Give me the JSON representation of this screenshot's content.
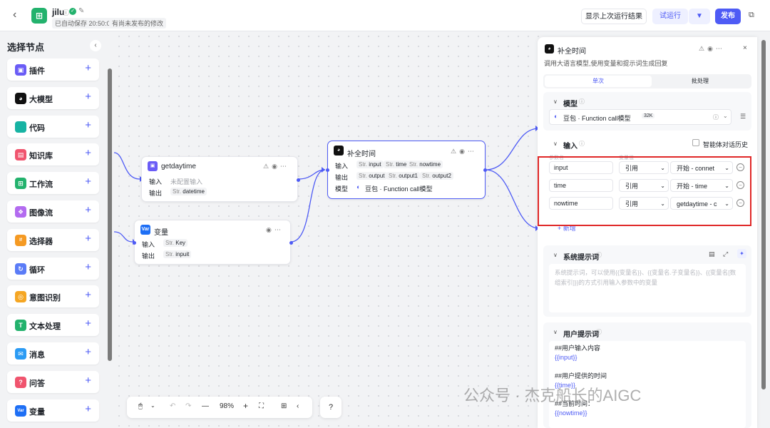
{
  "header": {
    "title": "jilu",
    "autosave": "已自动保存 20:50:03",
    "unpublished": "有尚未发布的修改",
    "show_last_run": "显示上次运行结果",
    "test_run": "试运行",
    "publish": "发布"
  },
  "sidebar": {
    "title": "选择节点",
    "items": [
      {
        "label": "插件",
        "icon": "plugin-icon",
        "color": "#6a5cf6"
      },
      {
        "label": "大模型",
        "icon": "llm-icon",
        "color": "#111111"
      },
      {
        "label": "代码",
        "icon": "code-icon",
        "color": "#17b3a3"
      },
      {
        "label": "知识库",
        "icon": "knowledge-icon",
        "color": "#f0546e"
      },
      {
        "label": "工作流",
        "icon": "workflow-icon",
        "color": "#23b26d"
      },
      {
        "label": "图像流",
        "icon": "imageflow-icon",
        "color": "#b36bf0"
      },
      {
        "label": "选择器",
        "icon": "selector-icon",
        "color": "#f59a23"
      },
      {
        "label": "循环",
        "icon": "loop-icon",
        "color": "#5b7cf7"
      },
      {
        "label": "意图识别",
        "icon": "intent-icon",
        "color": "#f5a623"
      },
      {
        "label": "文本处理",
        "icon": "text-icon",
        "color": "#23b26d"
      },
      {
        "label": "消息",
        "icon": "message-icon",
        "color": "#2b9bf4"
      },
      {
        "label": "问答",
        "icon": "qa-icon",
        "color": "#f0546e"
      },
      {
        "label": "变量",
        "icon": "variable-icon",
        "color": "#1e6ff5"
      }
    ]
  },
  "nodes": {
    "getdaytime": {
      "title": "getdaytime",
      "in_label": "输入",
      "in_value": "未配置输入",
      "out_label": "输出",
      "out_type": "Str.",
      "out_var": "datetime"
    },
    "variable": {
      "title": "变量",
      "icon_text": "Var",
      "in_label": "输入",
      "in_type": "Str.",
      "in_var": "Key",
      "out_label": "输出",
      "out_type": "Str.",
      "out_var": "inpuit"
    },
    "llm": {
      "title": "补全时间",
      "in_label": "输入",
      "ins": [
        "input",
        "time",
        "nowtime"
      ],
      "out_label": "输出",
      "outs": [
        "output",
        "output1",
        "output2"
      ],
      "type": "Str.",
      "model_label": "模型",
      "model": "豆包 · Function call模型"
    }
  },
  "panel": {
    "title": "补全时间",
    "desc": "调用大语言模型,使用变量和提示词生成回复",
    "tabs": [
      "单次",
      "批处理"
    ],
    "model_section": "模型",
    "model_name": "豆包 · Function call模型",
    "model_badge": "32K",
    "input_section": "输入",
    "history_label": "智能体对话历史",
    "col_name": "参数名",
    "col_value": "变量值",
    "rows": [
      {
        "name": "input",
        "mode": "引用",
        "ref": "开始 - connet"
      },
      {
        "name": "time",
        "mode": "引用",
        "ref": "开始 - time"
      },
      {
        "name": "nowtime",
        "mode": "引用",
        "ref": "getdaytime - c"
      }
    ],
    "add": "+ 新增",
    "sys_section": "系统提示词",
    "sys_placeholder": "系统提示词，可以使用{{变量名}}、{{变量名.子变量名}}、{{变量名[数组索引]}}的方式引用输入参数中的变量",
    "user_section": "用户提示词",
    "user_lines": [
      "##用户输入内容",
      "{{input}}",
      "",
      "##用户提供的时间",
      "{{time}}",
      "",
      "##当前时间：",
      "{{nowtime}}"
    ]
  },
  "toolbar": {
    "zoom": "98%"
  },
  "watermark": "公众号 · 杰克船长的AIGC",
  "colors": {
    "accent": "#4e5bf5",
    "highlight": "#e02828"
  }
}
